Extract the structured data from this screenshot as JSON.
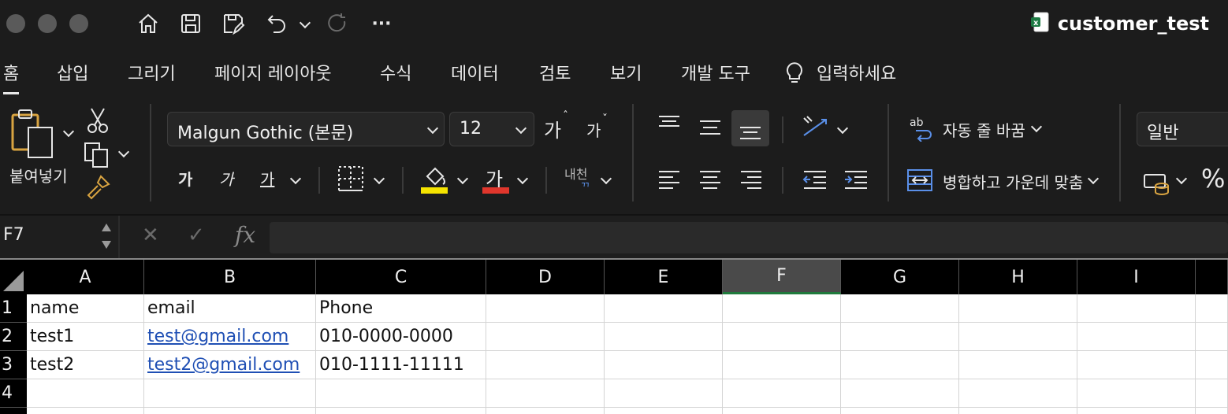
{
  "window": {
    "title": "customer_test",
    "toolbar_icons": [
      "home-icon",
      "save-icon",
      "save-edit-icon",
      "undo-icon",
      "redo-icon",
      "more-icon"
    ],
    "more_label": "···"
  },
  "tabs": [
    {
      "label": "홈",
      "active": true
    },
    {
      "label": "삽입"
    },
    {
      "label": "그리기"
    },
    {
      "label": "페이지 레이아웃"
    },
    {
      "label": "수식"
    },
    {
      "label": "데이터"
    },
    {
      "label": "검토"
    },
    {
      "label": "보기"
    },
    {
      "label": "개발 도구"
    }
  ],
  "tell_me": {
    "label": "입력하세요"
  },
  "ribbon": {
    "paste_label": "붙여넣기",
    "font_name": "Malgun Gothic (본문)",
    "font_size": "12",
    "grow_font": "가",
    "shrink_font": "가",
    "bold": "가",
    "italic": "가",
    "underline": "가",
    "font_color_glyph": "가",
    "phonetic": "내천",
    "wrap_text": "자동 줄 바꿈",
    "merge_center": "병합하고 가운데 맞춤",
    "number_format": "일반",
    "percent": "%",
    "colors": {
      "highlight": "#f5e400",
      "font_color": "#e0362c"
    }
  },
  "formula_bar": {
    "name_box": "F7",
    "cancel": "✕",
    "enter": "✓",
    "fx": "fx",
    "content": ""
  },
  "sheet": {
    "columns": [
      "A",
      "B",
      "C",
      "D",
      "E",
      "F",
      "G",
      "H",
      "I"
    ],
    "selected_column": "F",
    "rows": [
      {
        "num": "1",
        "cells": [
          "name",
          "email",
          "Phone"
        ]
      },
      {
        "num": "2",
        "cells": [
          "test1",
          "test@gmail.com",
          "010-0000-0000"
        ]
      },
      {
        "num": "3",
        "cells": [
          "test2",
          "test2@gmail.com",
          "010-1111-11111"
        ]
      },
      {
        "num": "4",
        "cells": [
          "",
          "",
          ""
        ]
      }
    ]
  }
}
